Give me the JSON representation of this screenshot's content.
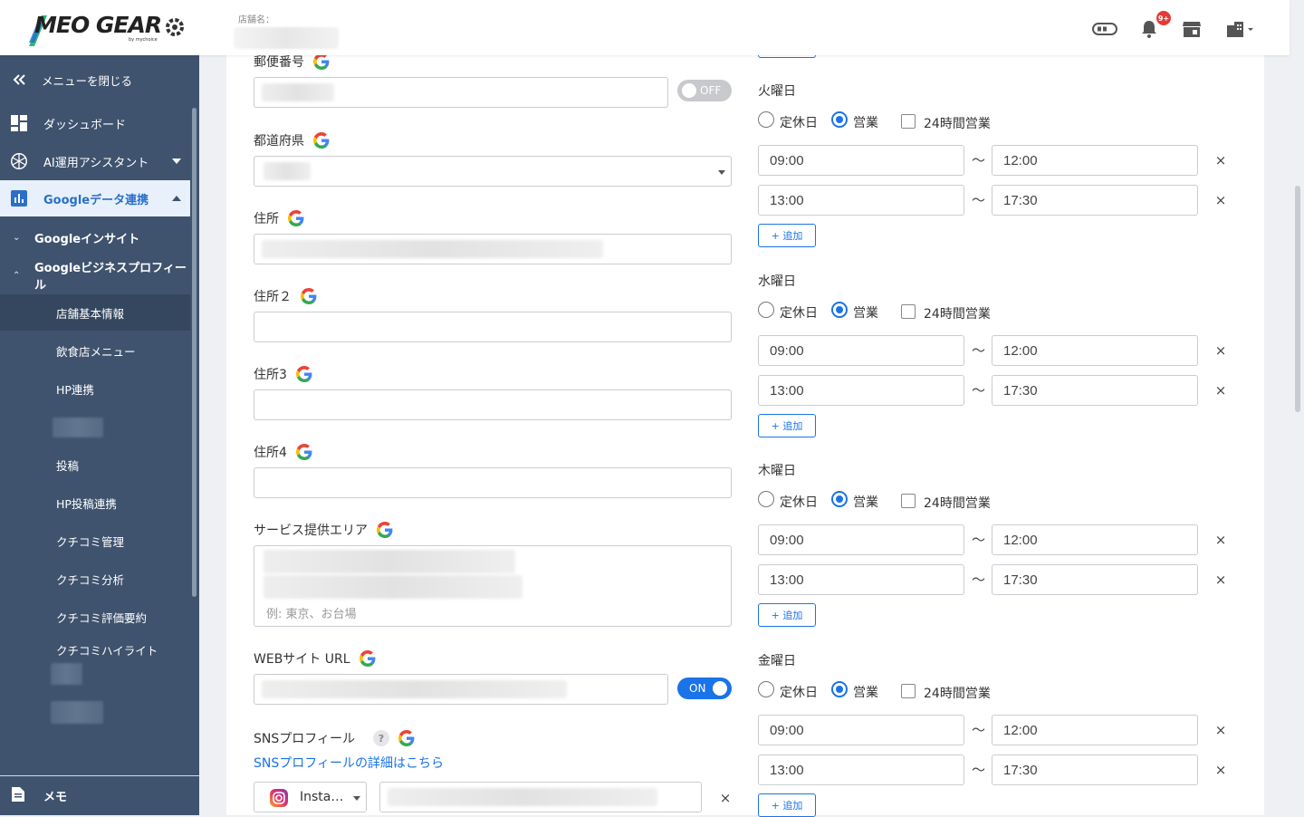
{
  "header": {
    "logo_text": "MEO GEAR",
    "logo_sub": "by mychoice",
    "store_label": "店舗名：",
    "notification_badge": "9+"
  },
  "sidebar": {
    "close_menu": "メニューを閉じる",
    "dashboard": "ダッシュボード",
    "ai_assistant": "AI運用アシスタント",
    "google_data": "Googleデータ連携",
    "google_insight": "Googleインサイト",
    "google_business_profile": "Googleビジネスプロフィール",
    "leaves": [
      "店舗基本情報",
      "飲食店メニュー",
      "HP連携",
      "",
      "投稿",
      "HP投稿連携",
      "クチコミ管理",
      "クチコミ分析",
      "クチコミ評価要約",
      "クチコミハイライト"
    ],
    "memo": "メモ"
  },
  "form": {
    "postal_label": "郵便番号",
    "postal_toggle": "OFF",
    "prefecture_label": "都道府県",
    "address_label": "住所",
    "address2_label": "住所２",
    "address3_label": "住所3",
    "address4_label": "住所4",
    "service_area_label": "サービス提供エリア",
    "service_area_placeholder": "例: 東京、お台場",
    "website_label": "WEBサイト URL",
    "website_toggle": "ON",
    "sns_label": "SNSプロフィール",
    "sns_help": "?",
    "sns_link": "SNSプロフィールの詳細はこちら",
    "sns_platform": "Insta…",
    "remove": "×"
  },
  "hours": {
    "closed_label": "定休日",
    "open_label": "営業",
    "all_day_label": "24時間営業",
    "tilde": "〜",
    "add_label": "+ 追加",
    "days": [
      {
        "name": "火曜日",
        "slots": [
          [
            "09:00",
            "12:00"
          ],
          [
            "13:00",
            "17:30"
          ]
        ]
      },
      {
        "name": "水曜日",
        "slots": [
          [
            "09:00",
            "12:00"
          ],
          [
            "13:00",
            "17:30"
          ]
        ]
      },
      {
        "name": "木曜日",
        "slots": [
          [
            "09:00",
            "12:00"
          ],
          [
            "13:00",
            "17:30"
          ]
        ]
      },
      {
        "name": "金曜日",
        "slots": [
          [
            "09:00",
            "12:00"
          ],
          [
            "13:00",
            "17:30"
          ]
        ]
      }
    ]
  },
  "colors": {
    "sidebar_bg": "#3f536e",
    "accent": "#1a73e8",
    "active_item_bg": "#e8f0fb"
  }
}
